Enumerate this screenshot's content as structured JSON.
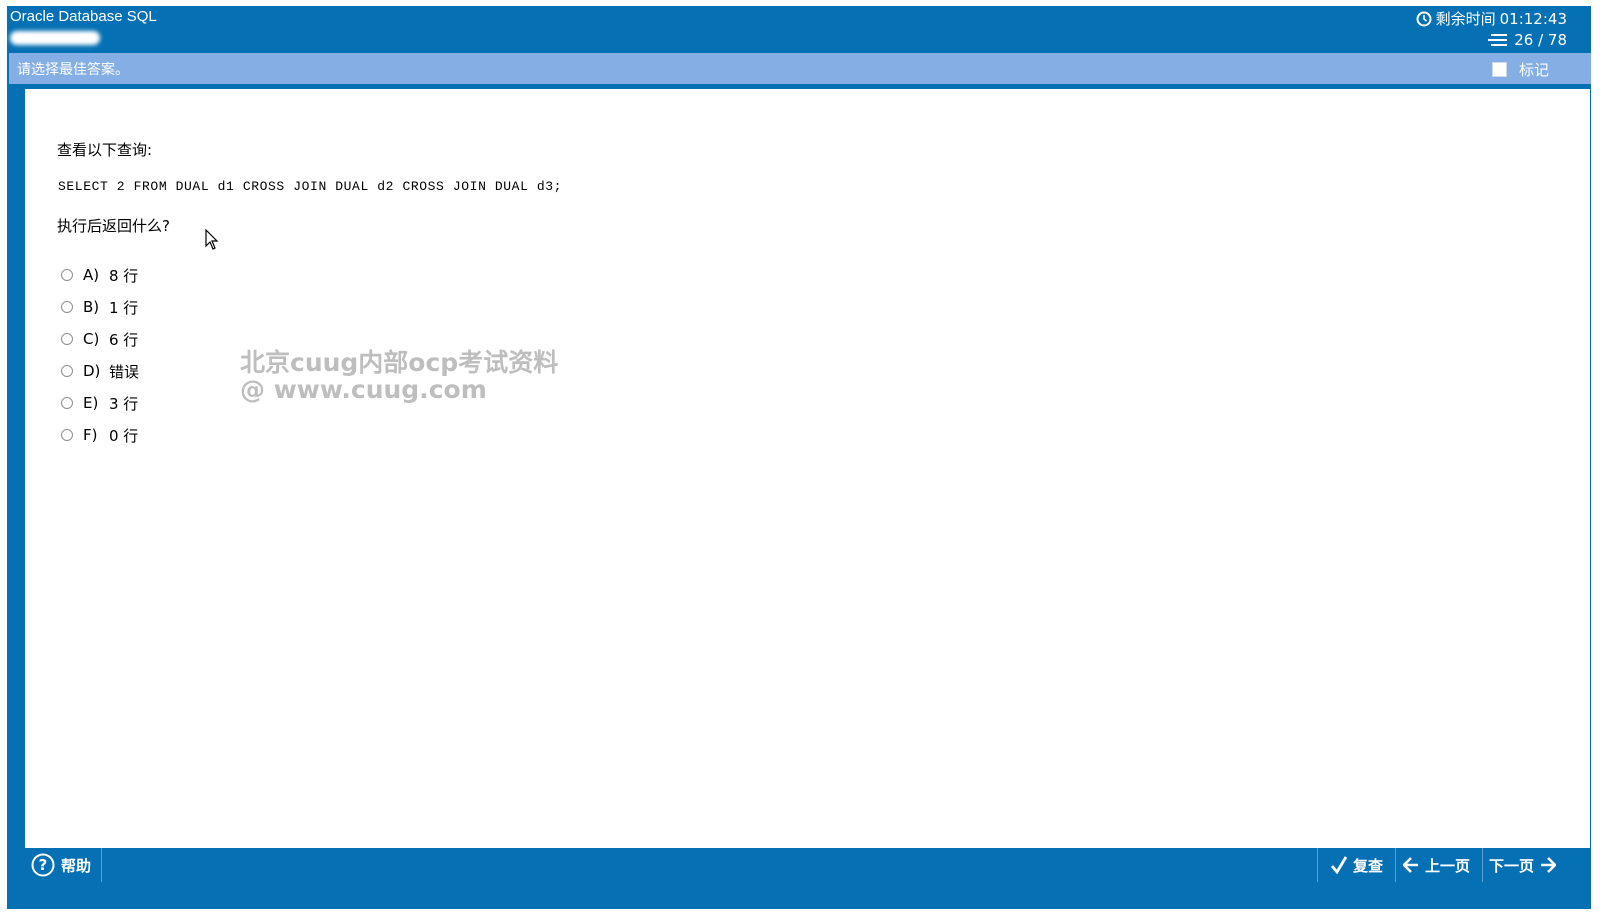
{
  "header": {
    "title": "Oracle Database SQL",
    "timer_label": "剩余时间",
    "timer_value": "01:12:43",
    "progress": "26 / 78"
  },
  "instruction": {
    "text": "请选择最佳答案。",
    "mark_label": "标记",
    "mark_checked": false
  },
  "question": {
    "intro": "查看以下查询:",
    "sql": "SELECT 2 FROM DUAL d1 CROSS JOIN DUAL d2 CROSS JOIN DUAL d3;",
    "ask": "执行后返回什么?",
    "options": [
      {
        "key": "A)",
        "text": "8 行"
      },
      {
        "key": "B)",
        "text": "1 行"
      },
      {
        "key": "C)",
        "text": "6 行"
      },
      {
        "key": "D)",
        "text": "错误"
      },
      {
        "key": "E)",
        "text": "3 行"
      },
      {
        "key": "F)",
        "text": "0 行"
      }
    ]
  },
  "watermark": {
    "line1": "北京cuug内部ocp考试资料",
    "line2": "@ www.cuug.com"
  },
  "footer": {
    "help_label": "帮助",
    "review_label": "复查",
    "prev_label": "上一页",
    "next_label": "下一页"
  },
  "colors": {
    "frame": "#0570b3",
    "instruction_bar": "#85aee5"
  }
}
